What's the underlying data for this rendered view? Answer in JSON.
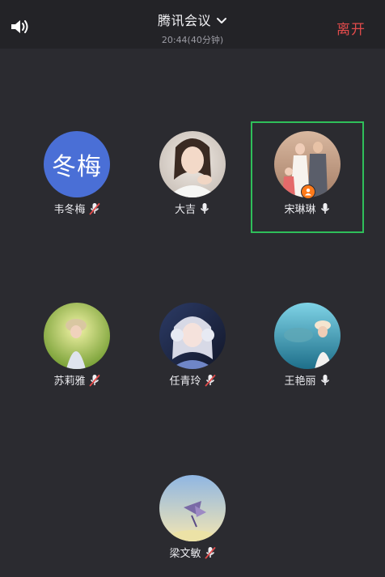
{
  "header": {
    "title": "腾讯会议",
    "subtitle": "20:44(40分钟)",
    "leave_label": "离开"
  },
  "icons": {
    "speaker": "speaker-icon",
    "dropdown": "chevron-down-icon",
    "mic_on": "mic-icon",
    "mic_off": "mic-muted-icon",
    "host": "host-badge-icon"
  },
  "colors": {
    "background": "#2b2b30",
    "topbar": "#232327",
    "leave": "#e24b4b",
    "active_border": "#2fbf5a",
    "text_avatar": "#4a6fd6",
    "host_badge": "#ff7a1a"
  },
  "participants": [
    {
      "name": "韦冬梅",
      "avatar_text": "冬梅",
      "mic": "muted"
    },
    {
      "name": "大吉",
      "avatar_text": "",
      "mic": "on"
    },
    {
      "name": "宋琳琳",
      "avatar_text": "",
      "mic": "on",
      "host": true,
      "active": true
    },
    {
      "name": "苏莉雅",
      "avatar_text": "",
      "mic": "muted"
    },
    {
      "name": "任青玲",
      "avatar_text": "",
      "mic": "muted"
    },
    {
      "name": "王艳丽",
      "avatar_text": "",
      "mic": "on"
    },
    {
      "name": "梁文敏",
      "avatar_text": "",
      "mic": "muted"
    }
  ]
}
